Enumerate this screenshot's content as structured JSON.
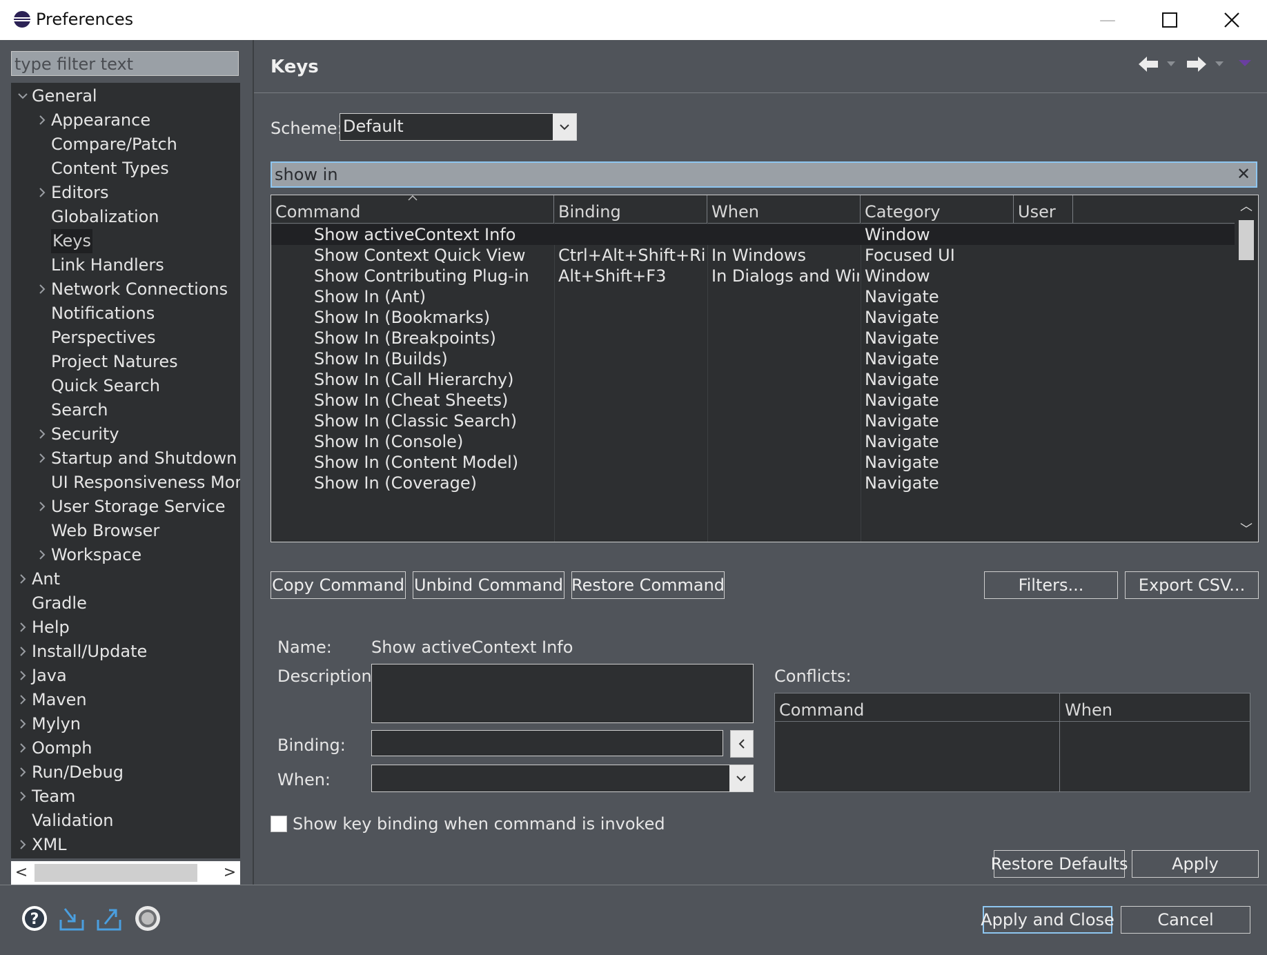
{
  "window": {
    "title": "Preferences",
    "minimize": "—",
    "maximize": "☐",
    "close": "✕"
  },
  "left": {
    "filter_placeholder": "type filter text",
    "tree": [
      {
        "label": "General",
        "level": 0,
        "twisty": "expanded"
      },
      {
        "label": "Appearance",
        "level": 1,
        "twisty": "collapsed"
      },
      {
        "label": "Compare/Patch",
        "level": 1,
        "twisty": "none"
      },
      {
        "label": "Content Types",
        "level": 1,
        "twisty": "none"
      },
      {
        "label": "Editors",
        "level": 1,
        "twisty": "collapsed"
      },
      {
        "label": "Globalization",
        "level": 1,
        "twisty": "none"
      },
      {
        "label": "Keys",
        "level": 1,
        "twisty": "none",
        "selected": true
      },
      {
        "label": "Link Handlers",
        "level": 1,
        "twisty": "none"
      },
      {
        "label": "Network Connections",
        "level": 1,
        "twisty": "collapsed"
      },
      {
        "label": "Notifications",
        "level": 1,
        "twisty": "none"
      },
      {
        "label": "Perspectives",
        "level": 1,
        "twisty": "none"
      },
      {
        "label": "Project Natures",
        "level": 1,
        "twisty": "none"
      },
      {
        "label": "Quick Search",
        "level": 1,
        "twisty": "none"
      },
      {
        "label": "Search",
        "level": 1,
        "twisty": "none"
      },
      {
        "label": "Security",
        "level": 1,
        "twisty": "collapsed"
      },
      {
        "label": "Startup and Shutdown",
        "level": 1,
        "twisty": "collapsed"
      },
      {
        "label": "UI Responsiveness Moni",
        "level": 1,
        "twisty": "none"
      },
      {
        "label": "User Storage Service",
        "level": 1,
        "twisty": "collapsed"
      },
      {
        "label": "Web Browser",
        "level": 1,
        "twisty": "none"
      },
      {
        "label": "Workspace",
        "level": 1,
        "twisty": "collapsed"
      },
      {
        "label": "Ant",
        "level": 0,
        "twisty": "collapsed"
      },
      {
        "label": "Gradle",
        "level": 0,
        "twisty": "none"
      },
      {
        "label": "Help",
        "level": 0,
        "twisty": "collapsed"
      },
      {
        "label": "Install/Update",
        "level": 0,
        "twisty": "collapsed"
      },
      {
        "label": "Java",
        "level": 0,
        "twisty": "collapsed"
      },
      {
        "label": "Maven",
        "level": 0,
        "twisty": "collapsed"
      },
      {
        "label": "Mylyn",
        "level": 0,
        "twisty": "collapsed"
      },
      {
        "label": "Oomph",
        "level": 0,
        "twisty": "collapsed"
      },
      {
        "label": "Run/Debug",
        "level": 0,
        "twisty": "collapsed"
      },
      {
        "label": "Team",
        "level": 0,
        "twisty": "collapsed"
      },
      {
        "label": "Validation",
        "level": 0,
        "twisty": "none"
      },
      {
        "label": "XML",
        "level": 0,
        "twisty": "collapsed"
      }
    ],
    "scroll_left": "<",
    "scroll_right": ">"
  },
  "page": {
    "title": "Keys",
    "scheme_label": "Scheme:",
    "scheme_value": "Default",
    "search_value": "show in",
    "table": {
      "columns": [
        "Command",
        "Binding",
        "When",
        "Category",
        "User"
      ],
      "rows": [
        [
          "Show activeContext Info",
          "",
          "",
          "Window",
          ""
        ],
        [
          "Show Context Quick View",
          "Ctrl+Alt+Shift+Right",
          "In Windows",
          "Focused UI",
          ""
        ],
        [
          "Show Contributing Plug-in",
          "Alt+Shift+F3",
          "In Dialogs and Windo...",
          "Window",
          ""
        ],
        [
          "Show In (Ant)",
          "",
          "",
          "Navigate",
          ""
        ],
        [
          "Show In (Bookmarks)",
          "",
          "",
          "Navigate",
          ""
        ],
        [
          "Show In (Breakpoints)",
          "",
          "",
          "Navigate",
          ""
        ],
        [
          "Show In (Builds)",
          "",
          "",
          "Navigate",
          ""
        ],
        [
          "Show In (Call Hierarchy)",
          "",
          "",
          "Navigate",
          ""
        ],
        [
          "Show In (Cheat Sheets)",
          "",
          "",
          "Navigate",
          ""
        ],
        [
          "Show In (Classic Search)",
          "",
          "",
          "Navigate",
          ""
        ],
        [
          "Show In (Console)",
          "",
          "",
          "Navigate",
          ""
        ],
        [
          "Show In (Content Model)",
          "",
          "",
          "Navigate",
          ""
        ],
        [
          "Show In (Coverage)",
          "",
          "",
          "Navigate",
          ""
        ]
      ]
    },
    "buttons": {
      "copy": "Copy Command",
      "unbind": "Unbind Command",
      "restore": "Restore Command",
      "filters": "Filters...",
      "export": "Export CSV..."
    },
    "details": {
      "name_label": "Name:",
      "name_value": "Show activeContext Info",
      "description_label": "Description:",
      "binding_label": "Binding:",
      "when_label": "When:",
      "conflicts_label": "Conflicts:",
      "conflict_columns": [
        "Command",
        "When"
      ]
    },
    "show_binding_checkbox": "Show key binding when command is invoked",
    "restore_defaults": "Restore Defaults",
    "apply": "Apply"
  },
  "footer": {
    "apply_close": "Apply and Close",
    "cancel": "Cancel"
  },
  "colors": {
    "accent": "#8ec6f0",
    "panel": "#50545a",
    "list_bg": "#2d2f31"
  }
}
